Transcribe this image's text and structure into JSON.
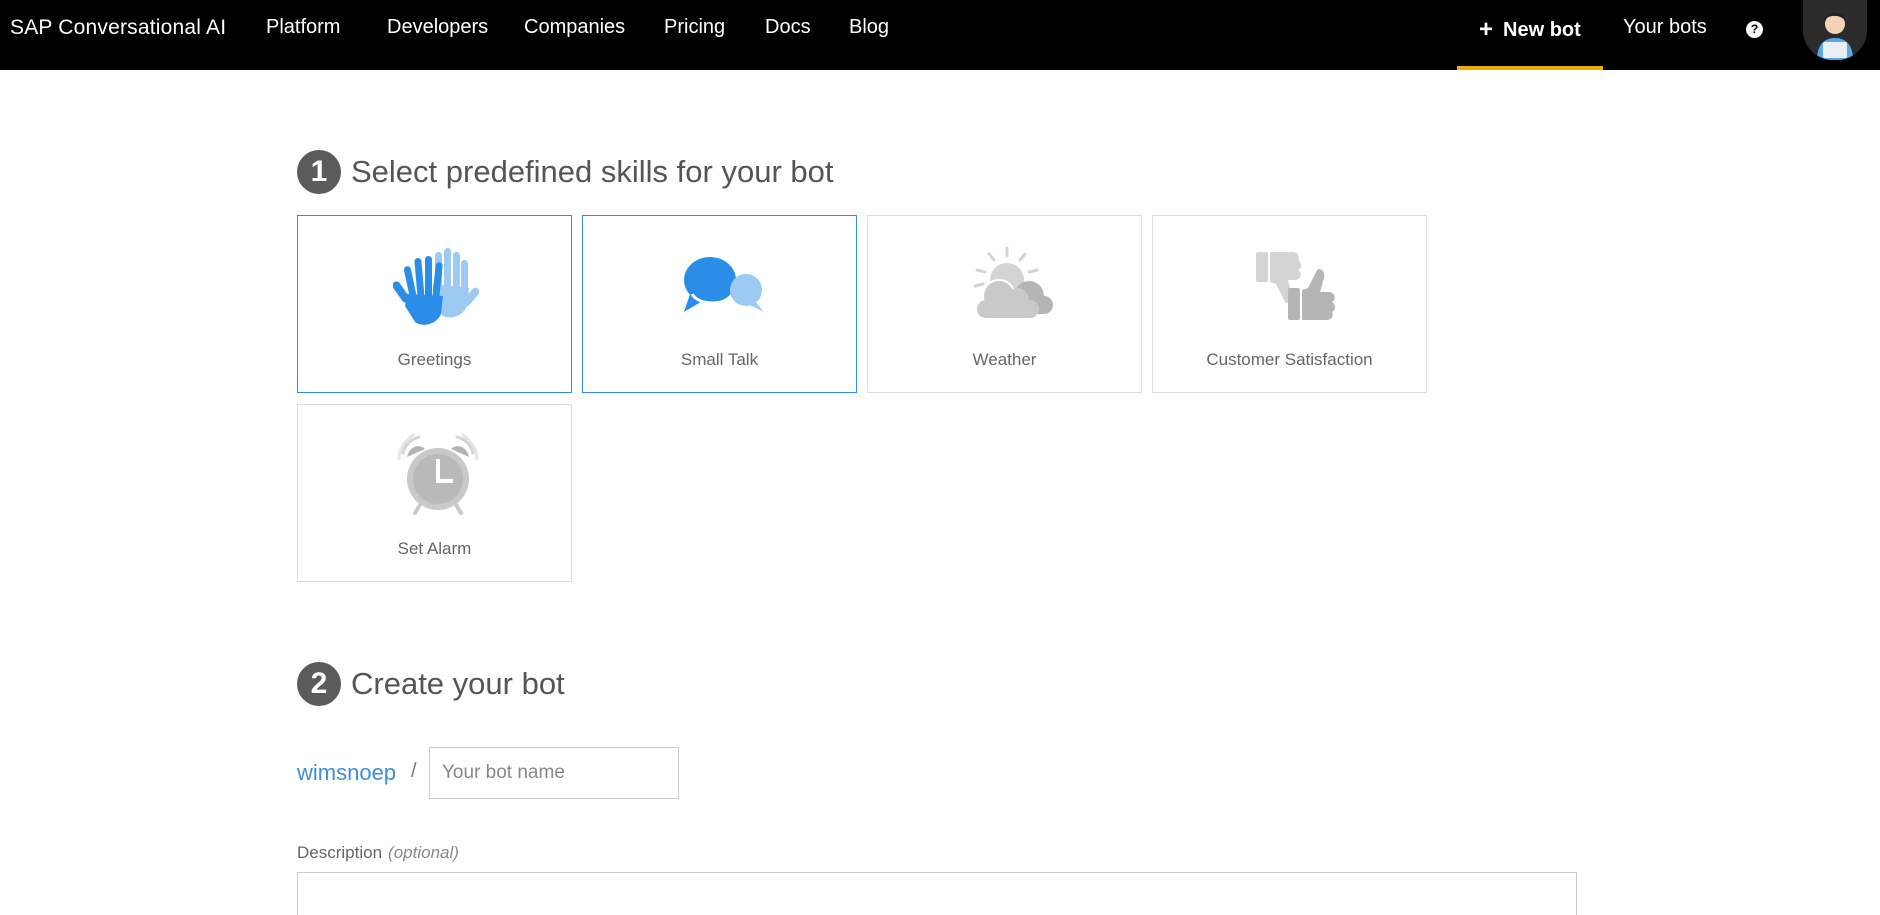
{
  "brand": "SAP Conversational AI",
  "nav": {
    "platform": "Platform",
    "developers": "Developers",
    "companies": "Companies",
    "pricing": "Pricing",
    "docs": "Docs",
    "blog": "Blog",
    "new_bot": "New bot",
    "your_bots": "Your bots",
    "help": "?"
  },
  "accent_color": "#f0ab00",
  "selected_color": "#2a8ee8",
  "step1": {
    "number": "1",
    "title": "Select predefined skills for your bot"
  },
  "skills": [
    {
      "label": "Greetings",
      "icon": "waving-hands-icon",
      "selected": true
    },
    {
      "label": "Small Talk",
      "icon": "chat-bubbles-icon",
      "selected": true
    },
    {
      "label": "Weather",
      "icon": "sun-cloud-icon",
      "selected": false
    },
    {
      "label": "Customer Satisfaction",
      "icon": "thumbs-icon",
      "selected": false
    },
    {
      "label": "Set Alarm",
      "icon": "alarm-clock-icon",
      "selected": false
    }
  ],
  "step2": {
    "number": "2",
    "title": "Create your bot"
  },
  "form": {
    "owner": "wimsnoep",
    "separator": "/",
    "bot_name_placeholder": "Your bot name",
    "bot_name_value": "",
    "description_label": "Description",
    "description_optional": "(optional)",
    "description_value": ""
  }
}
